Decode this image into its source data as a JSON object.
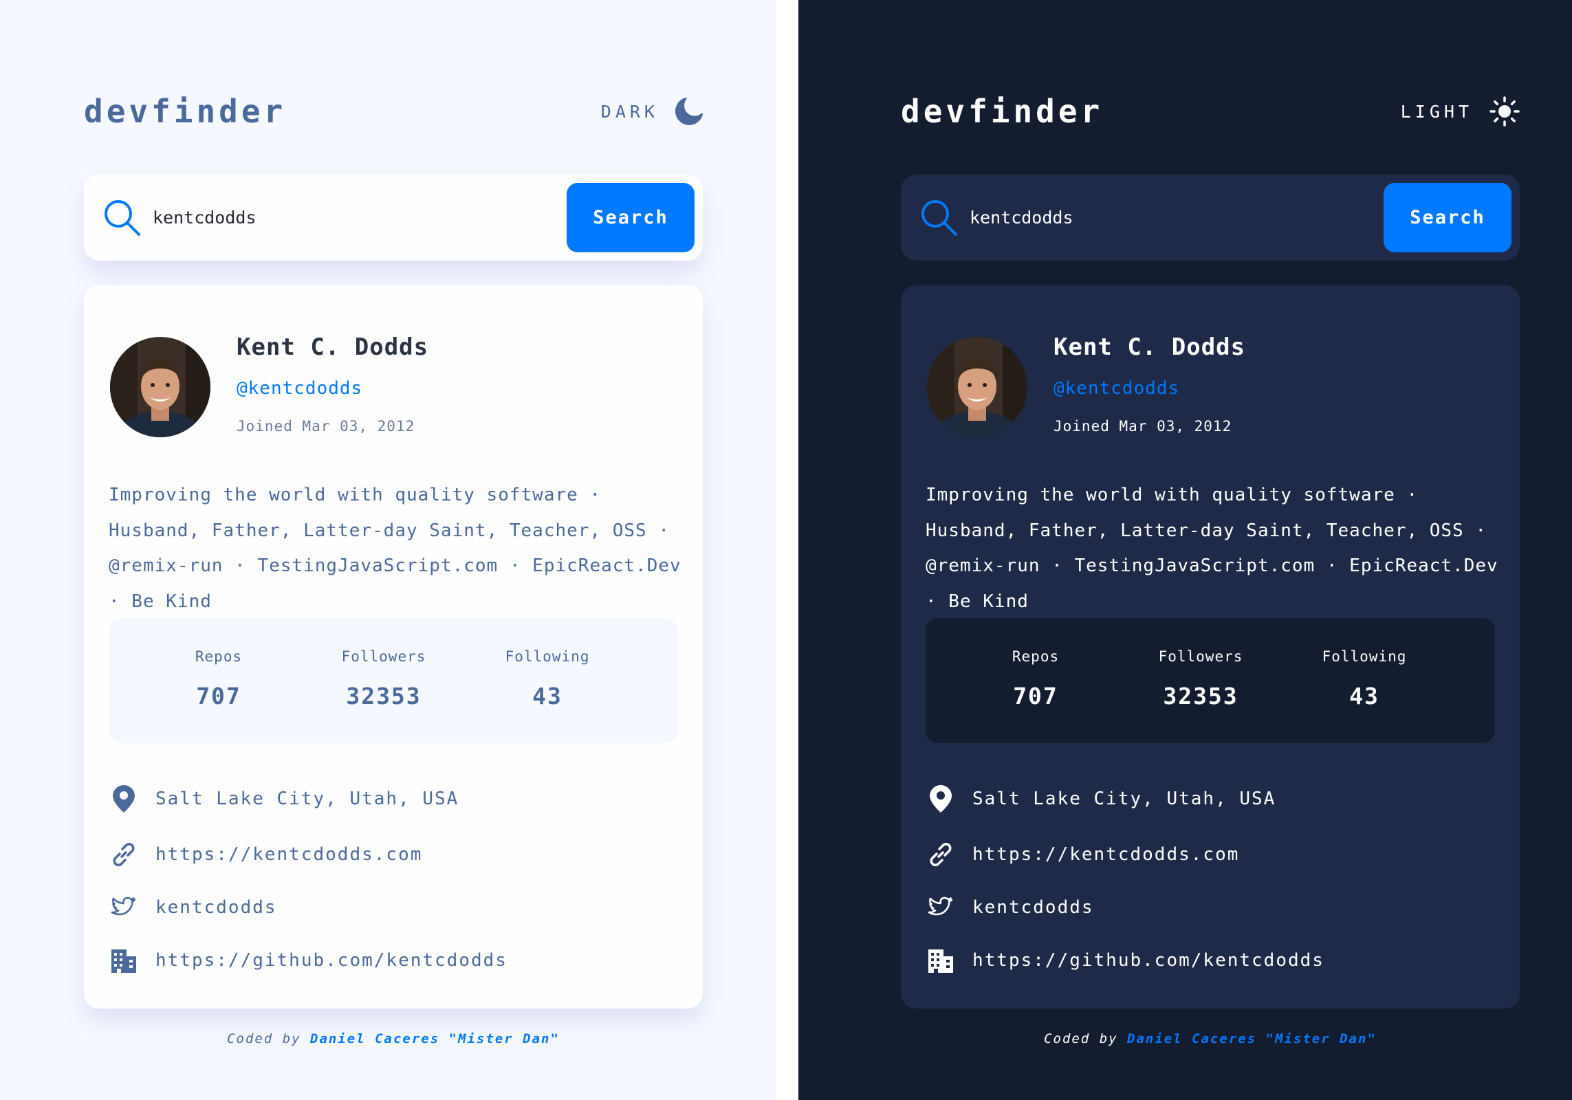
{
  "colors": {
    "accent": "#0079ff",
    "light_bg": "#f6f8ff",
    "light_card": "#fefefe",
    "light_text": "#4b6a9b",
    "dark_bg": "#141d2f",
    "dark_card": "#1e2a47",
    "dark_text": "#ffffff"
  },
  "light": {
    "logo": "devfinder",
    "theme_label": "DARK",
    "theme_icon": "moon-icon",
    "search": {
      "value": "kentcdodds",
      "button": "Search"
    },
    "profile": {
      "name": "Kent C. Dodds",
      "login": "@kentcdodds",
      "joined": "Joined Mar 03, 2012",
      "bio": "Improving the world with quality software · Husband, Father, Latter-day Saint, Teacher, OSS · @remix-run · TestingJavaScript.com · EpicReact.Dev · Be Kind",
      "stats": {
        "repos_label": "Repos",
        "repos": "707",
        "followers_label": "Followers",
        "followers": "32353",
        "following_label": "Following",
        "following": "43"
      },
      "location": "Salt Lake City, Utah, USA",
      "blog": "https://kentcdodds.com",
      "twitter": "kentcdodds",
      "company": "https://github.com/kentcdodds"
    },
    "footer": {
      "prefix": "Coded by",
      "author": "Daniel Caceres \"Mister Dan\""
    }
  },
  "dark": {
    "logo": "devfinder",
    "theme_label": "LIGHT",
    "theme_icon": "sun-icon",
    "search": {
      "value": "kentcdodds",
      "button": "Search"
    },
    "profile": {
      "name": "Kent C. Dodds",
      "login": "@kentcdodds",
      "joined": "Joined Mar 03, 2012",
      "bio": "Improving the world with quality software · Husband, Father, Latter-day Saint, Teacher, OSS · @remix-run · TestingJavaScript.com · EpicReact.Dev · Be Kind",
      "stats": {
        "repos_label": "Repos",
        "repos": "707",
        "followers_label": "Followers",
        "followers": "32353",
        "following_label": "Following",
        "following": "43"
      },
      "location": "Salt Lake City, Utah, USA",
      "blog": "https://kentcdodds.com",
      "twitter": "kentcdodds",
      "company": "https://github.com/kentcdodds"
    },
    "footer": {
      "prefix": "Coded by",
      "author": "Daniel Caceres \"Mister Dan\""
    }
  }
}
